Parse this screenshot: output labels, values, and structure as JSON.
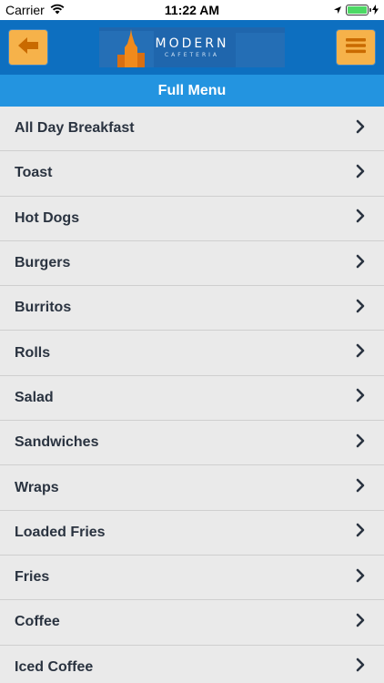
{
  "status_bar": {
    "carrier": "Carrier",
    "time": "11:22 AM",
    "battery_level": 1.0
  },
  "header": {
    "back_icon": "arrow-left-icon",
    "menu_icon": "hamburger-menu-icon",
    "logo_text": "MODERN",
    "logo_subtext": "CAFETERIA",
    "colors": {
      "header_bg": "#0d6fc0",
      "button_bg": "#f6b24a",
      "icon_color": "#c96a00"
    }
  },
  "title": "Full Menu",
  "menu_items": [
    {
      "label": "All Day Breakfast"
    },
    {
      "label": "Toast"
    },
    {
      "label": "Hot Dogs"
    },
    {
      "label": "Burgers"
    },
    {
      "label": "Burritos"
    },
    {
      "label": "Rolls"
    },
    {
      "label": "Salad"
    },
    {
      "label": "Sandwiches"
    },
    {
      "label": "Wraps"
    },
    {
      "label": "Loaded Fries"
    },
    {
      "label": "Fries"
    },
    {
      "label": "Coffee"
    },
    {
      "label": "Iced Coffee"
    }
  ],
  "chevron_icon": "chevron-right-icon"
}
